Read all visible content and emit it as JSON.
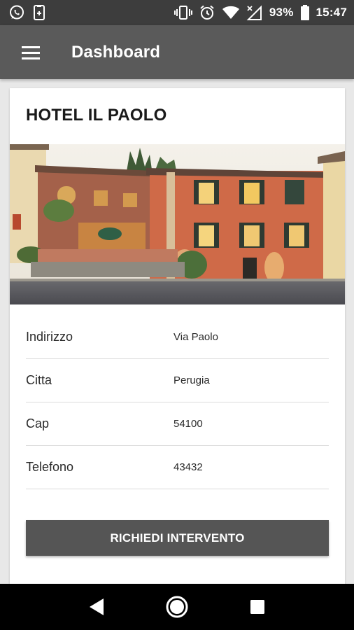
{
  "status_bar": {
    "battery_percent": "93%",
    "time": "15:47",
    "icons": [
      "whatsapp-icon",
      "sim-notification-icon",
      "vibrate-icon",
      "alarm-icon",
      "wifi-icon",
      "signal-icon",
      "battery-icon"
    ]
  },
  "app_bar": {
    "title": "Dashboard",
    "menu_icon": "hamburger-menu-icon"
  },
  "hotel": {
    "name": "HOTEL IL PAOLO",
    "image": "hotel-photo",
    "details": [
      {
        "label": "Indirizzo",
        "value": "Via Paolo"
      },
      {
        "label": "Citta",
        "value": "Perugia"
      },
      {
        "label": "Cap",
        "value": "54100"
      },
      {
        "label": "Telefono",
        "value": "43432"
      }
    ]
  },
  "action": {
    "label": "RICHIEDI INTERVENTO"
  },
  "nav_bar": {
    "icons": [
      "back-icon",
      "home-icon",
      "recents-icon"
    ]
  },
  "colors": {
    "status_bar": "#3d3d3d",
    "app_bar": "#5a5a5a",
    "button": "#555555",
    "background": "#e8e8e8"
  }
}
